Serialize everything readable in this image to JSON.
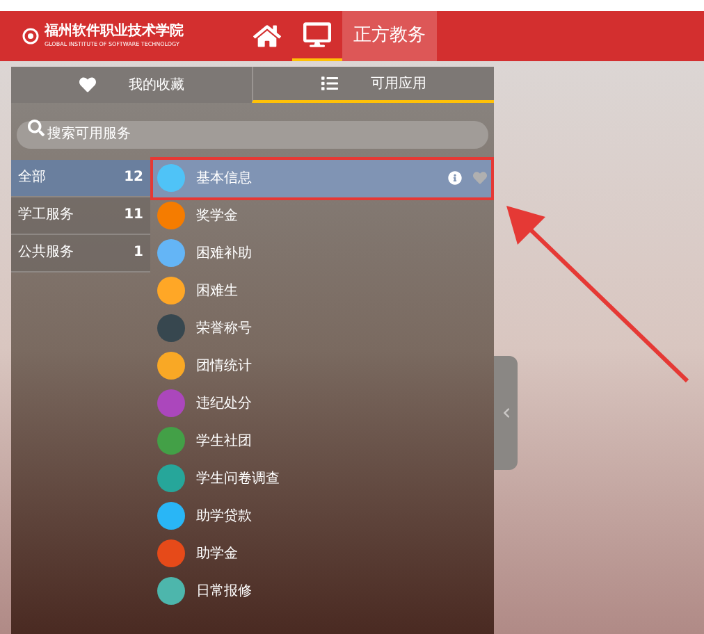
{
  "header": {
    "logo_name": "福州软件职业技术学院",
    "logo_subtitle": "GLOBAL INSTITUTE OF SOFTWARE TECHNOLOGY",
    "nav": [
      {
        "kind": "home",
        "selected": false
      },
      {
        "kind": "desktop",
        "selected": true
      },
      {
        "kind": "text",
        "label": "正方教务",
        "selected": false
      }
    ]
  },
  "tabs": [
    {
      "kind": "heart",
      "label": "我的收藏",
      "selected": false
    },
    {
      "kind": "list",
      "label": "可用应用",
      "selected": true
    }
  ],
  "search": {
    "placeholder": "搜索可用服务"
  },
  "categories": [
    {
      "label": "全部",
      "count": "12",
      "selected": true
    },
    {
      "label": "学工服务",
      "count": "11",
      "selected": false
    },
    {
      "label": "公共服务",
      "count": "1",
      "selected": false
    }
  ],
  "apps": [
    {
      "label": "基本信息",
      "color": "#4fc3f7",
      "selected": true
    },
    {
      "label": "奖学金",
      "color": "#f57c00",
      "selected": false
    },
    {
      "label": "困难补助",
      "color": "#64b5f6",
      "selected": false
    },
    {
      "label": "困难生",
      "color": "#ffa726",
      "selected": false
    },
    {
      "label": "荣誉称号",
      "color": "#37474f",
      "selected": false
    },
    {
      "label": "团情统计",
      "color": "#f9a825",
      "selected": false
    },
    {
      "label": "违纪处分",
      "color": "#ab47bc",
      "selected": false
    },
    {
      "label": "学生社团",
      "color": "#43a047",
      "selected": false
    },
    {
      "label": "学生问卷调查",
      "color": "#26a69a",
      "selected": false
    },
    {
      "label": "助学贷款",
      "color": "#29b6f6",
      "selected": false
    },
    {
      "label": "助学金",
      "color": "#e64a19",
      "selected": false
    },
    {
      "label": "日常报修",
      "color": "#4db6ac",
      "selected": false
    }
  ]
}
